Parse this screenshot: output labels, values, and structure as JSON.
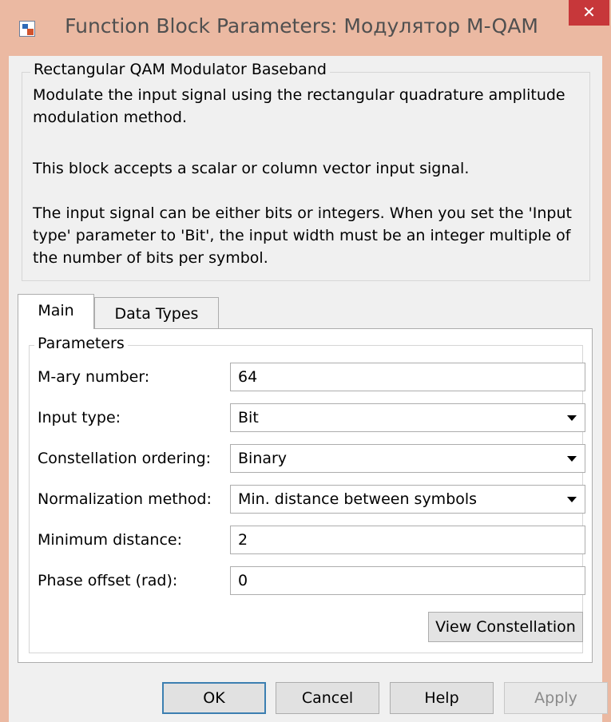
{
  "window": {
    "title": "Function Block Parameters: Модулятор M-QAM",
    "close_glyph": "✕"
  },
  "description": {
    "legend": "Rectangular QAM Modulator Baseband",
    "para1": "Modulate the input signal using the rectangular quadrature amplitude modulation method.",
    "para2": "This block accepts a scalar or column vector input signal.",
    "para3": "The input signal can be either bits or integers. When you set the 'Input type' parameter to 'Bit', the input width must be an integer multiple of the number of bits per symbol."
  },
  "tabs": [
    {
      "label": "Main",
      "active": true
    },
    {
      "label": "Data Types",
      "active": false
    }
  ],
  "parameters": {
    "legend": "Parameters",
    "m_ary": {
      "label": "M-ary number:",
      "value": "64"
    },
    "input_type": {
      "label": "Input type:",
      "value": "Bit"
    },
    "constellation_ordering": {
      "label": "Constellation ordering:",
      "value": "Binary"
    },
    "normalization_method": {
      "label": "Normalization method:",
      "value": "Min. distance between symbols"
    },
    "minimum_distance": {
      "label": "Minimum distance:",
      "value": "2"
    },
    "phase_offset": {
      "label": "Phase offset (rad):",
      "value": "0"
    },
    "view_constellation_label": "View Constellation"
  },
  "buttons": {
    "ok": "OK",
    "cancel": "Cancel",
    "help": "Help",
    "apply": "Apply"
  },
  "colors": {
    "title_bar": "#ebb9a2",
    "close_button": "#c7373a",
    "dialog_background": "#f0f0f0",
    "panel_background": "#ffffff",
    "ok_border": "#3c7fb1"
  }
}
